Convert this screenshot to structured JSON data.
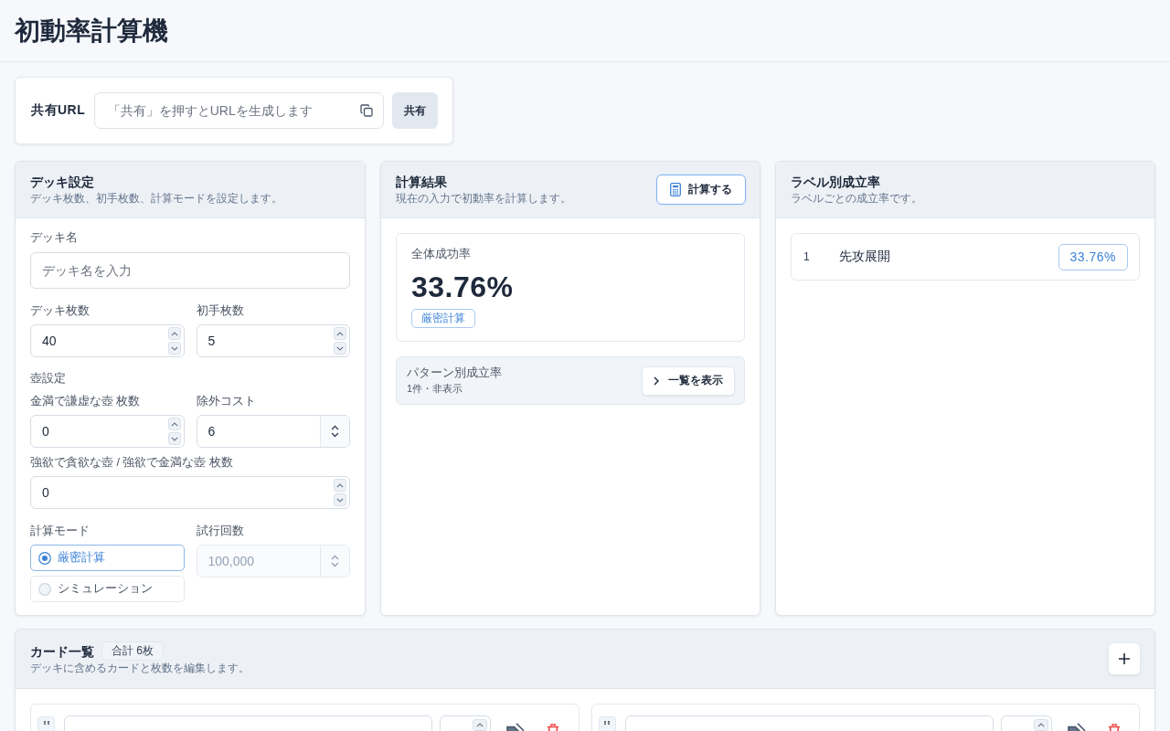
{
  "header": {
    "title": "初動率計算機"
  },
  "share": {
    "label": "共有URL",
    "url_field": {
      "placeholder": "「共有」を押すとURLを生成します"
    },
    "button": "共有"
  },
  "deck_settings": {
    "title": "デッキ設定",
    "subtitle": "デッキ枚数、初手枚数、計算モードを設定します。",
    "deck_name": {
      "label": "デッキ名",
      "placeholder": "デッキ名を入力"
    },
    "deck_size": {
      "label": "デッキ枚数",
      "value": "40",
      "kind": "stepper"
    },
    "hand_size": {
      "label": "初手枚数",
      "value": "5",
      "kind": "stepper"
    },
    "pot_settings": {
      "heading": "壺設定",
      "moderation_count": {
        "label": "金満で謙虚な壺 枚数",
        "value": "0",
        "kind": "stepper"
      },
      "banish_cost": {
        "label": "除外コスト",
        "value": "6",
        "kind": "select"
      },
      "greed_count": {
        "label": "強欲で貪欲な壺 / 強欲で金満な壺 枚数",
        "value": "0",
        "kind": "stepper"
      }
    },
    "mode": {
      "label": "計算モード",
      "options": [
        {
          "label": "厳密計算",
          "selected": true
        },
        {
          "label": "シミュレーション",
          "selected": false
        }
      ]
    },
    "trials": {
      "label": "試行回数",
      "value": "100,000",
      "kind": "select",
      "disabled": true
    }
  },
  "result": {
    "title": "計算結果",
    "subtitle": "現在の入力で初動率を計算します。",
    "calculate_button": {
      "label": "計算する",
      "focused": true
    },
    "overall": {
      "label": "全体成功率",
      "value": "33.76%",
      "mode_badge": "厳密計算"
    },
    "patterns": {
      "title": "パターン別成立率",
      "summary": "1件・非表示",
      "button": "一覧を表示"
    }
  },
  "label_rates": {
    "title": "ラベル別成立率",
    "subtitle": "ラベルごとの成立率です。",
    "rows": [
      {
        "index": "1",
        "name": "先攻展開",
        "rate": "33.76%"
      }
    ]
  },
  "card_list": {
    "title": "カード一覧",
    "total_badge": "合計 6枚",
    "subtitle": "デッキに含めるカードと枚数を編集します。"
  }
}
